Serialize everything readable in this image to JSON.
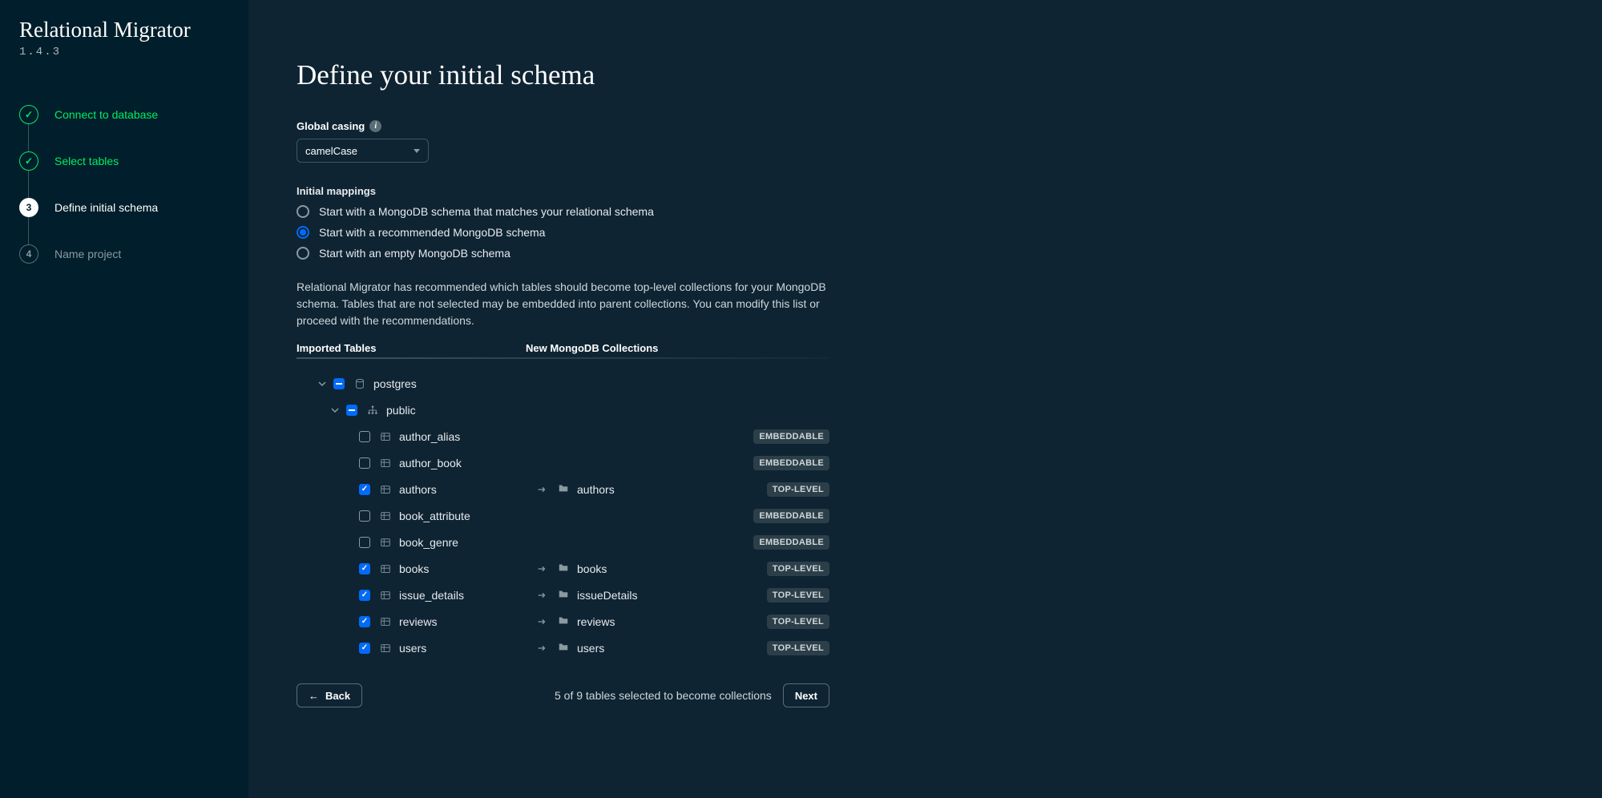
{
  "app": {
    "title": "Relational Migrator",
    "version": "1.4.3"
  },
  "steps": [
    {
      "label": "Connect to database"
    },
    {
      "label": "Select tables"
    },
    {
      "num": "3",
      "label": "Define initial schema"
    },
    {
      "num": "4",
      "label": "Name project"
    }
  ],
  "page": {
    "title": "Define your initial schema",
    "casingLabel": "Global casing",
    "casingValue": "camelCase",
    "mappingsLabel": "Initial mappings",
    "radios": [
      "Start with a MongoDB schema that matches your relational schema",
      "Start with a recommended MongoDB schema",
      "Start with an empty MongoDB schema"
    ],
    "description": "Relational Migrator has recommended which tables should become top-level collections for your MongoDB schema. Tables that are not selected may be embedded into parent collections. You can modify this list or proceed with the recommendations.",
    "leftHeader": "Imported Tables",
    "rightHeader": "New MongoDB Collections",
    "dbName": "postgres",
    "schemaName": "public",
    "tables": [
      {
        "name": "author_alias",
        "checked": false,
        "badge": "EMBEDDABLE",
        "collection": null
      },
      {
        "name": "author_book",
        "checked": false,
        "badge": "EMBEDDABLE",
        "collection": null
      },
      {
        "name": "authors",
        "checked": true,
        "badge": "TOP-LEVEL",
        "collection": "authors"
      },
      {
        "name": "book_attribute",
        "checked": false,
        "badge": "EMBEDDABLE",
        "collection": null
      },
      {
        "name": "book_genre",
        "checked": false,
        "badge": "EMBEDDABLE",
        "collection": null
      },
      {
        "name": "books",
        "checked": true,
        "badge": "TOP-LEVEL",
        "collection": "books"
      },
      {
        "name": "issue_details",
        "checked": true,
        "badge": "TOP-LEVEL",
        "collection": "issueDetails"
      },
      {
        "name": "reviews",
        "checked": true,
        "badge": "TOP-LEVEL",
        "collection": "reviews"
      },
      {
        "name": "users",
        "checked": true,
        "badge": "TOP-LEVEL",
        "collection": "users"
      }
    ],
    "backLabel": "Back",
    "nextLabel": "Next",
    "countText": "5 of 9 tables selected to become collections"
  }
}
